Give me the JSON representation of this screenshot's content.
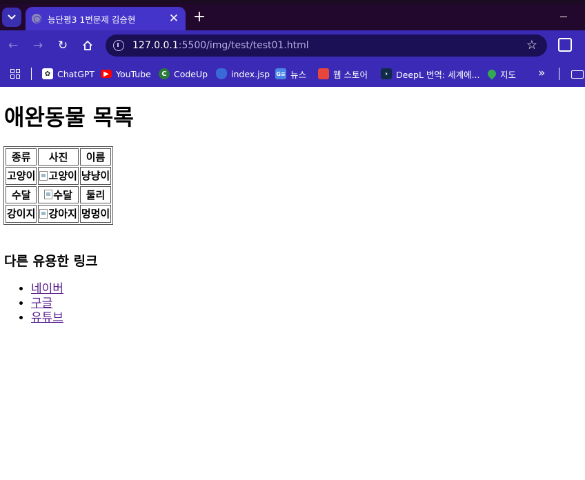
{
  "browser": {
    "tab_title": "능단평3 1번문제 김승현",
    "url_host": "127.0.0.1",
    "url_path": ":5500/img/test/test01.html",
    "bookmarks": [
      {
        "label": "ChatGPT",
        "icon": "chatgpt-icon",
        "color": "#ffffff"
      },
      {
        "label": "YouTube",
        "icon": "youtube-icon",
        "color": "#ff0000"
      },
      {
        "label": "CodeUp",
        "icon": "codeup-icon",
        "color": "#2a7a3a"
      },
      {
        "label": "index.jsp",
        "icon": "shield-icon",
        "color": "#3a6ad8"
      },
      {
        "label": "뉴스",
        "icon": "news-icon",
        "color": "#4a86e8"
      },
      {
        "label": "웹 스토어",
        "icon": "store-icon",
        "color": "#e8453c"
      },
      {
        "label": "DeepL 번역: 세계에...",
        "icon": "deepl-icon",
        "color": "#0f2b46"
      },
      {
        "label": "지도",
        "icon": "maps-icon",
        "color": "#34a853"
      }
    ]
  },
  "page": {
    "title": "애완동물 목록",
    "table": {
      "headers": [
        "종류",
        "사진",
        "이름"
      ],
      "rows": [
        {
          "kind": "고양이",
          "photo_alt": "고양이",
          "name": "냥냥이"
        },
        {
          "kind": "수달",
          "photo_alt": "수달",
          "name": "둘리"
        },
        {
          "kind": "강이지",
          "photo_alt": "강아지",
          "name": "멍멍이"
        }
      ]
    },
    "links_heading": "다른 유용한 링크",
    "links": [
      "네이버",
      "구글",
      "유튜브"
    ]
  }
}
